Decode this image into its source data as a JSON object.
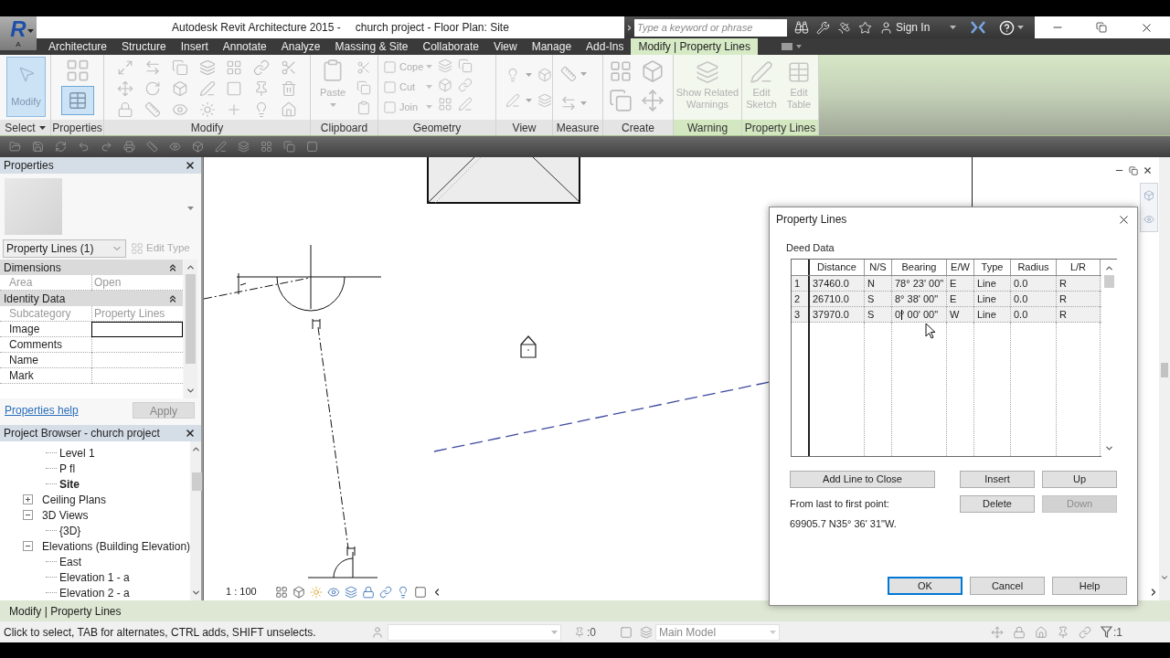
{
  "window": {
    "app_logo": "R",
    "app_edition": "A",
    "app_name": "Autodesk Revit Architecture 2015 -",
    "document": "church project - Floor Plan: Site"
  },
  "help_bar": {
    "search": {
      "placeholder": "Type a keyword or phrase"
    },
    "sign_in": "Sign In"
  },
  "ribbon": {
    "tabs": [
      {
        "label": "Architecture",
        "selected": false
      },
      {
        "label": "Structure",
        "selected": false
      },
      {
        "label": "Insert",
        "selected": false
      },
      {
        "label": "Annotate",
        "selected": false
      },
      {
        "label": "Analyze",
        "selected": false
      },
      {
        "label": "Massing & Site",
        "selected": false
      },
      {
        "label": "Collaborate",
        "selected": false
      },
      {
        "label": "View",
        "selected": false
      },
      {
        "label": "Manage",
        "selected": false
      },
      {
        "label": "Add-Ins",
        "selected": false
      },
      {
        "label": "Modify | Property Lines",
        "selected": true
      }
    ],
    "panels": [
      {
        "title": "Select",
        "kind": "select",
        "contextual": false,
        "button": {
          "label": "Modify",
          "selected": true
        }
      },
      {
        "title": "Properties",
        "kind": "properties",
        "contextual": false,
        "toggle": {
          "selected": true
        }
      },
      {
        "title": "Modify",
        "kind": "modify",
        "contextual": false
      },
      {
        "title": "Clipboard",
        "kind": "clipboard",
        "contextual": false,
        "button": {
          "label": "Paste",
          "disabled": true
        }
      },
      {
        "title": "Geometry",
        "kind": "geometry",
        "contextual": false,
        "buttons": [
          {
            "label": "Cope",
            "disabled": true
          },
          {
            "label": "Cut",
            "disabled": true
          },
          {
            "label": "Join",
            "disabled": true
          }
        ]
      },
      {
        "title": "View",
        "kind": "view",
        "contextual": false
      },
      {
        "title": "Measure",
        "kind": "measure",
        "contextual": false
      },
      {
        "title": "Create",
        "kind": "create",
        "contextual": false
      },
      {
        "title": "Warning",
        "kind": "warning",
        "contextual": true,
        "buttons": [
          {
            "label": "Show Related Warnings",
            "disabled": true
          }
        ]
      },
      {
        "title": "Property Lines",
        "kind": "property_lines",
        "contextual": true,
        "buttons": [
          {
            "label": "Edit Sketch",
            "disabled": true
          },
          {
            "label": "Edit Table",
            "disabled": true
          }
        ]
      }
    ]
  },
  "properties": {
    "title": "Properties",
    "type_selector": "Property Lines (1)",
    "edit_type": {
      "label": "Edit Type",
      "disabled": true
    },
    "groups": [
      {
        "name": "Dimensions",
        "expanded": true,
        "rows": [
          {
            "label": "Area",
            "value": "Open",
            "read_only": true,
            "selected": false
          }
        ]
      },
      {
        "name": "Identity Data",
        "expanded": true,
        "rows": [
          {
            "label": "Subcategory",
            "value": "Property Lines",
            "read_only": true,
            "selected": false
          },
          {
            "label": "Image",
            "read_only": false,
            "selected": true
          },
          {
            "label": "Comments",
            "read_only": false,
            "selected": false
          },
          {
            "label": "Name",
            "read_only": false,
            "selected": false
          },
          {
            "label": "Mark",
            "read_only": false,
            "selected": false
          }
        ]
      }
    ],
    "help_link": "Properties help",
    "apply": {
      "label": "Apply",
      "disabled": true
    }
  },
  "project_browser": {
    "title": "Project Browser - church project",
    "tree": [
      {
        "children": [
          {
            "label": "Level 1",
            "selected": false
          },
          {
            "label": "P fl",
            "selected": false
          },
          {
            "label": "Site",
            "selected": true
          }
        ]
      },
      {
        "label": "Ceiling Plans",
        "expanded": false,
        "selected": false
      },
      {
        "label": "3D Views",
        "expanded": true,
        "selected": false,
        "children": [
          {
            "label": "{3D}",
            "selected": false
          }
        ]
      },
      {
        "label": "Elevations (Building Elevation)",
        "expanded": true,
        "selected": false,
        "children": [
          {
            "label": "East",
            "selected": false
          },
          {
            "label": "Elevation 1 - a",
            "selected": false
          },
          {
            "label": "Elevation 2 - a",
            "selected": false
          }
        ]
      }
    ]
  },
  "view": {
    "scale": "1 : 100"
  },
  "dialog": {
    "title": "Property Lines",
    "section": "Deed Data",
    "table": {
      "columns": [
        "Distance",
        "N/S",
        "Bearing",
        "E/W",
        "Type",
        "Radius",
        "L/R"
      ],
      "rows": [
        {
          "number": "1",
          "cells": [
            "37460.0",
            "N",
            "78° 23' 00\"",
            "E",
            "Line",
            "0.0",
            "R"
          ],
          "editing": false
        },
        {
          "number": "2",
          "cells": [
            "26710.0",
            "S",
            "8° 38' 00\"",
            "E",
            "Line",
            "0.0",
            "R"
          ],
          "editing": false
        },
        {
          "number": "3",
          "cells": [
            "37970.0",
            "S",
            "0° 00' 00\"",
            "W",
            "Line",
            "0.0",
            "R"
          ],
          "editing": true
        }
      ]
    },
    "add_line_button": {
      "label": "Add Line to Close",
      "disabled": false
    },
    "row_buttons": [
      {
        "label": "Insert",
        "disabled": false
      },
      {
        "label": "Up",
        "disabled": false
      },
      {
        "label": "Delete",
        "disabled": false
      },
      {
        "label": "Down",
        "disabled": true
      }
    ],
    "closing_label": "From last to first point:",
    "closing_value": "69905.7 N35° 36' 31\"W.",
    "footer_buttons": [
      {
        "label": "OK",
        "focused": true
      },
      {
        "label": "Cancel",
        "focused": false
      },
      {
        "label": "Help",
        "focused": false
      }
    ]
  },
  "context_bar": {
    "label": "Modify | Property Lines"
  },
  "status_bar": {
    "message": "Click to select, TAB for alternates, CTRL adds, SHIFT unselects.",
    "counter": ":0",
    "design_option": "Main Model",
    "filter_count": ":1"
  }
}
